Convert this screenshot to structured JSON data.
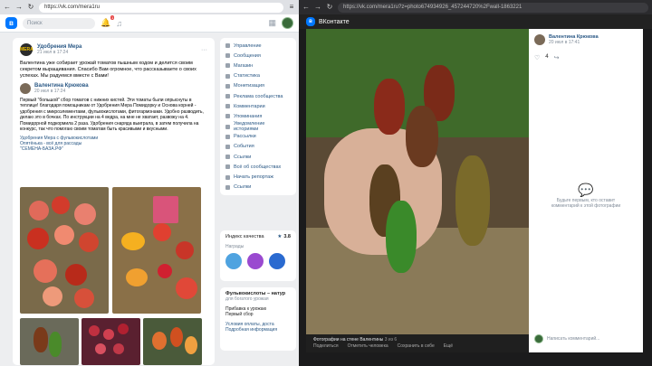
{
  "left": {
    "url": "https://vk.com/mera1ru",
    "search_placeholder": "Поиск",
    "notif_count": "1",
    "post": {
      "author": "Удобрения Мера",
      "date": "21 июл в 17:24",
      "text": "Валентина уже собирает урожай томатов пышным ходом и делится своим секретом выращивания. Спасибо Вам огромное, что рассказываете о своих успехах. Мы радуемся вместе с Вами!",
      "repost_author": "Валентина Крюкова",
      "repost_date": "20 июл в 17:24",
      "repost_text": "Первый \"большой\" сбор томатов с нижних кистей. Эти томаты были опрыснуты в теплице! благодаря помощникам от Удобрения Мера Помидорку и Основа корней - удобрения с микроэлементами, фульвокислотами, фитогармонами. Удобно разводить, делаю это в бочках. По инструкции на 4 ведра, на мне не хватает, развожу на 4. Помидорной подкормила 2 раза. Удобрения снаряда выиграла, в затем получила на конкурс, так что помогаю своим томатам быть красивыми и вкусными.",
      "tags": "Удобрения Мера с фульвокислотами",
      "link1": "Опятёнька - всё для рассады",
      "link2": "\"СЕМЕНА-БАЗА.РФ\""
    },
    "sidebar": [
      "Управление",
      "Сообщения",
      "Магазин",
      "Статистика",
      "Монетизация",
      "Реклама сообщества",
      "Комментарии",
      "Упоминания",
      "Уведомление историями",
      "Рассылки",
      "События",
      "Ссылки",
      "Всё об сообществах",
      "Начать репортаж",
      "Ссылки"
    ],
    "quality": {
      "label": "Индекс качества",
      "value": "3.8",
      "awards": "Награды"
    },
    "promo": {
      "title": "Фульвокислоты – натур",
      "subtitle": "для богатого урожая",
      "item1": "Прибавка к урожаю",
      "item2": "Первый сбор",
      "link1": "Условия оплаты, доста",
      "link2": "Подробная информация"
    }
  },
  "right": {
    "url": "https://vk.com/mera1ru?z=photo674934926_457244720%2Fwall-1863221",
    "brand": "ВКонтакте",
    "author": "Валентина Крюкова",
    "date": "20 июл в 17:41",
    "likes": "4",
    "empty_title": "Будьте первым, кто оставит",
    "empty_sub": "комментарий к этой фотографии",
    "caption": "Фотографии на стене Валентины",
    "caption_count": "3 из 6",
    "actions": [
      "Поделиться",
      "Отметить человека",
      "Сохранить в себе",
      "Ещё"
    ],
    "comment_placeholder": "Написать комментарий..."
  }
}
